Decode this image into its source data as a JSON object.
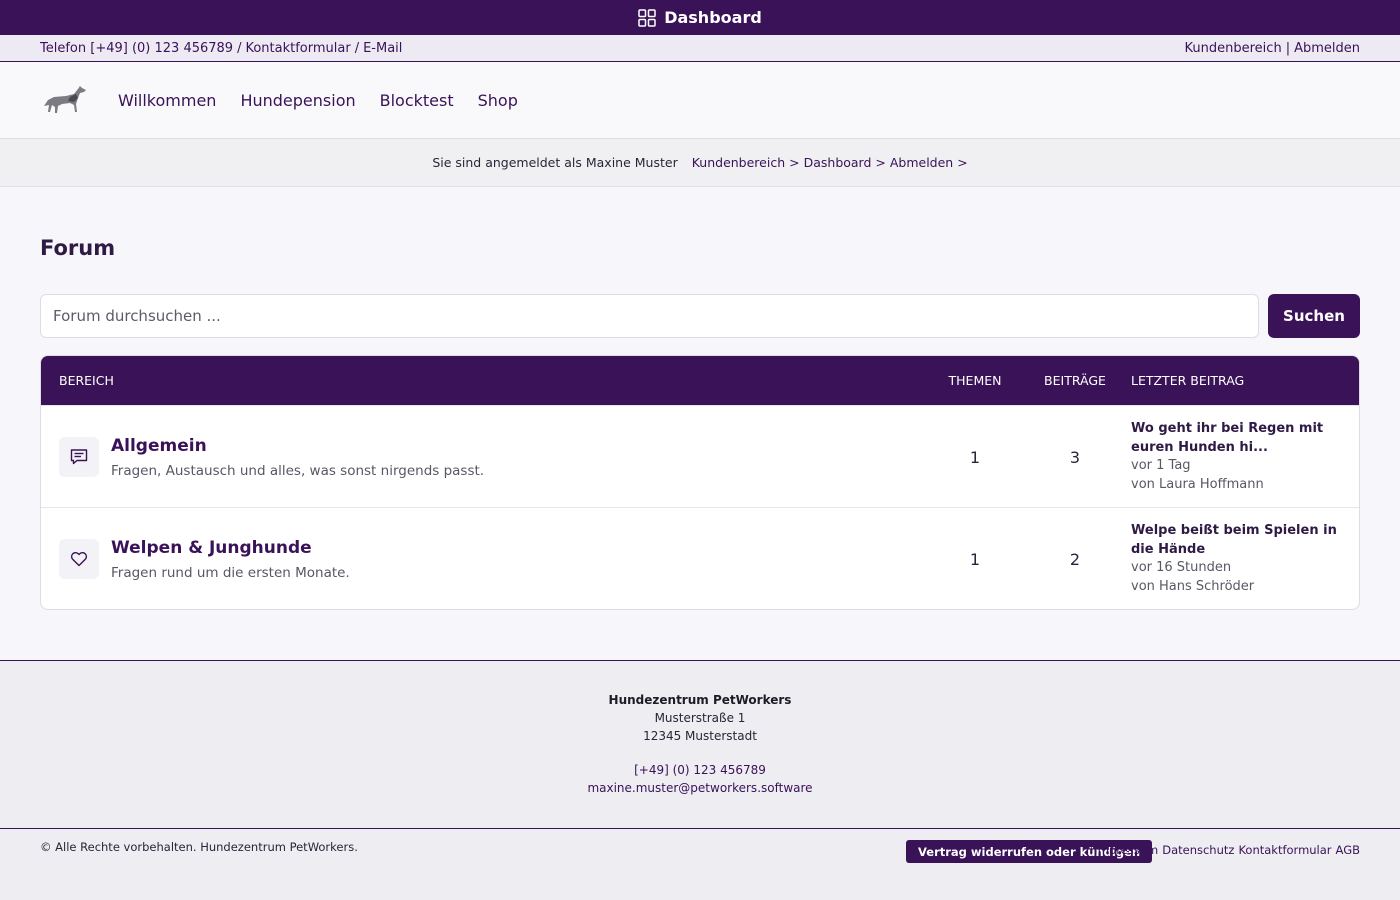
{
  "topbar": {
    "title": "Dashboard",
    "icon": "dashboard-grid-icon"
  },
  "infobar": {
    "phone": "Telefon [+49] (0) 123 456789",
    "sep1": "/",
    "contact_form": "Kontaktformular",
    "sep2": "/",
    "email": "E-Mail",
    "customer_area": "Kundenbereich",
    "sep3": "|",
    "logout": "Abmelden"
  },
  "nav": {
    "logo_icon": "dog-logo-icon",
    "items": [
      "Willkommen",
      "Hundepension",
      "Blocktest",
      "Shop"
    ]
  },
  "breadcrumb": {
    "logged_in_as": "Sie sind angemeldet als Maxine Muster",
    "items": [
      "Kundenbereich >",
      "Dashboard >",
      "Abmelden >"
    ]
  },
  "forum": {
    "title": "Forum",
    "search_placeholder": "Forum durchsuchen ...",
    "search_button": "Suchen",
    "columns": {
      "bereich": "BEREICH",
      "themen": "THEMEN",
      "beitraege": "BEITRÄGE",
      "letzter": "LETZTER BEITRAG"
    },
    "rows": [
      {
        "icon": "chat-bubble-icon",
        "name": "Allgemein",
        "description": "Fragen, Austausch und alles, was sonst nirgends passt.",
        "themen": "1",
        "beitraege": "3",
        "last_title": "Wo geht ihr bei Regen mit euren Hunden hi...",
        "last_time": "vor 1 Tag",
        "last_author": "von Laura Hoffmann"
      },
      {
        "icon": "heart-icon",
        "name": "Welpen & Junghunde",
        "description": "Fragen rund um die ersten Monate.",
        "themen": "1",
        "beitraege": "2",
        "last_title": "Welpe beißt beim Spielen in die Hände",
        "last_time": "vor 16 Stunden",
        "last_author": "von Hans Schröder"
      }
    ]
  },
  "footer": {
    "company": "Hundezentrum PetWorkers",
    "street": "Musterstraße 1",
    "city": "12345 Musterstadt",
    "phone": "[+49] (0) 123 456789",
    "email": "maxine.muster@petworkers.software"
  },
  "bottombar": {
    "copyright": "© Alle Rechte vorbehalten. Hundezentrum PetWorkers.",
    "cancel_button": "Vertrag widerrufen oder kündigen",
    "links": [
      "Impressum",
      "Datenschutz",
      "Kontaktformular",
      "AGB"
    ]
  },
  "colors": {
    "brand": "#3a1258",
    "background": "#f7f6fa"
  }
}
